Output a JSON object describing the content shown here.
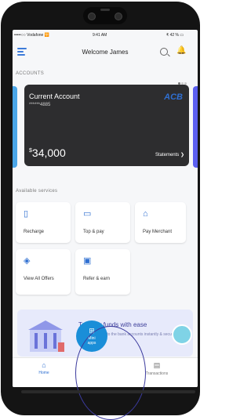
{
  "status": {
    "carrier": "•••••○○ Vodafone 🛜",
    "time": "9:41 AM",
    "battery": "₹ 42 % ▭"
  },
  "header": {
    "title": "Welcome James"
  },
  "accounts": {
    "section_label": "ACCOUNTS",
    "card": {
      "name": "Current Account",
      "masked": "******4885",
      "bank_logo": "ACB",
      "currency": "$",
      "balance": "34,000",
      "statements_label": "Statements ❯"
    }
  },
  "services": {
    "section_label": "Available services",
    "items": [
      {
        "label": "Recharge",
        "icon": "phone-icon"
      },
      {
        "label": "Top & pay",
        "icon": "card-icon"
      },
      {
        "label": "Pay Merchant",
        "icon": "shop-icon"
      },
      {
        "label": "View All Offers",
        "icon": "offer-icon"
      },
      {
        "label": "Refer & earn",
        "icon": "gift-icon"
      }
    ]
  },
  "banner": {
    "title": "Transfer funds with ease",
    "subtitle": "Transfer money to the bank accounts instantly & securely"
  },
  "tabbar": {
    "home": "Home",
    "mini_apps": "Mini\napps",
    "transactions": "Transactions"
  },
  "colors": {
    "accent": "#2f6fd1",
    "fab": "#1a8ed8",
    "card": "#2d2d2f"
  }
}
